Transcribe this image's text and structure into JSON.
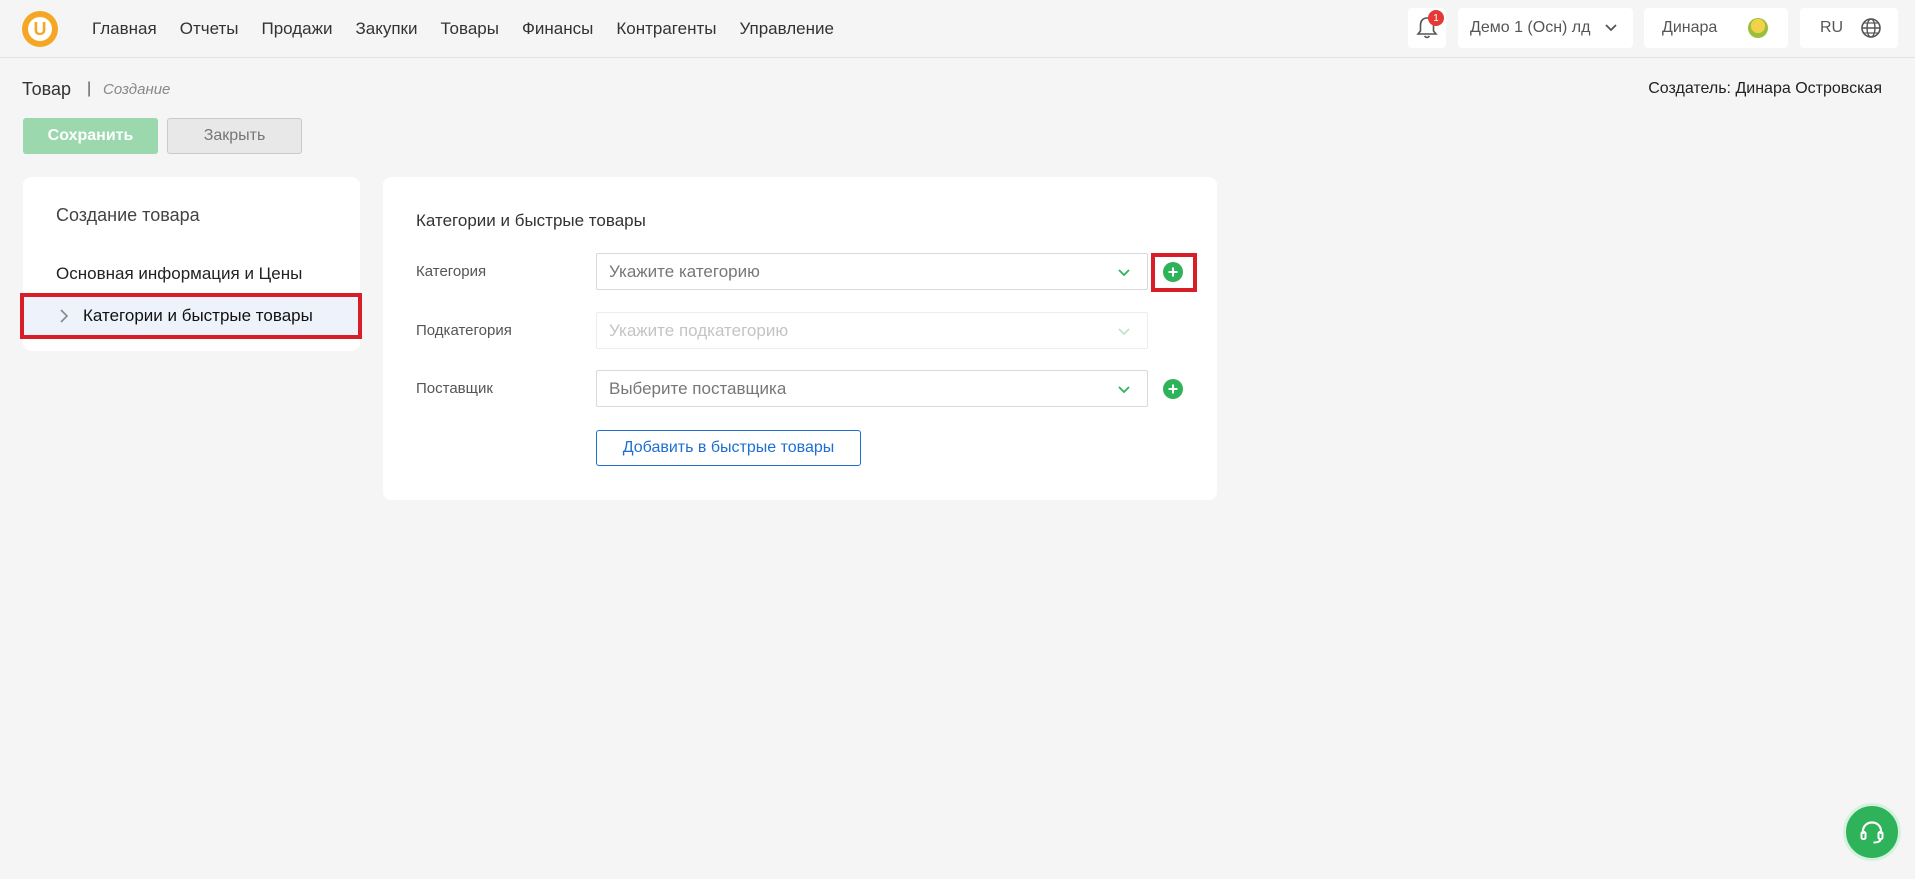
{
  "nav": {
    "items": [
      "Главная",
      "Отчеты",
      "Продажи",
      "Закупки",
      "Товары",
      "Финансы",
      "Контрагенты",
      "Управление"
    ]
  },
  "header": {
    "notification_count": "1",
    "org": "Демо 1 (Осн) лд",
    "user": "Динара",
    "lang": "RU"
  },
  "page": {
    "title": "Товар",
    "separator": "|",
    "subtitle": "Создание",
    "creator": "Создатель: Динара Островская"
  },
  "actions": {
    "save": "Сохранить",
    "close": "Закрыть"
  },
  "sidebar": {
    "title": "Создание товара",
    "items": [
      "Основная информация и Цены",
      "Категории и быстрые товары"
    ]
  },
  "form": {
    "section_title": "Категории и быстрые товары",
    "category_label": "Категория",
    "category_placeholder": "Укажите категорию",
    "subcategory_label": "Подкатегория",
    "subcategory_placeholder": "Укажите подкатегорию",
    "supplier_label": "Поставщик",
    "supplier_placeholder": "Выберите поставщика",
    "quick_button": "Добавить в быстрые товары"
  },
  "colors": {
    "accent_green": "#2fb35a",
    "highlight_red": "#d81e26",
    "link_blue": "#1d6fd1"
  }
}
